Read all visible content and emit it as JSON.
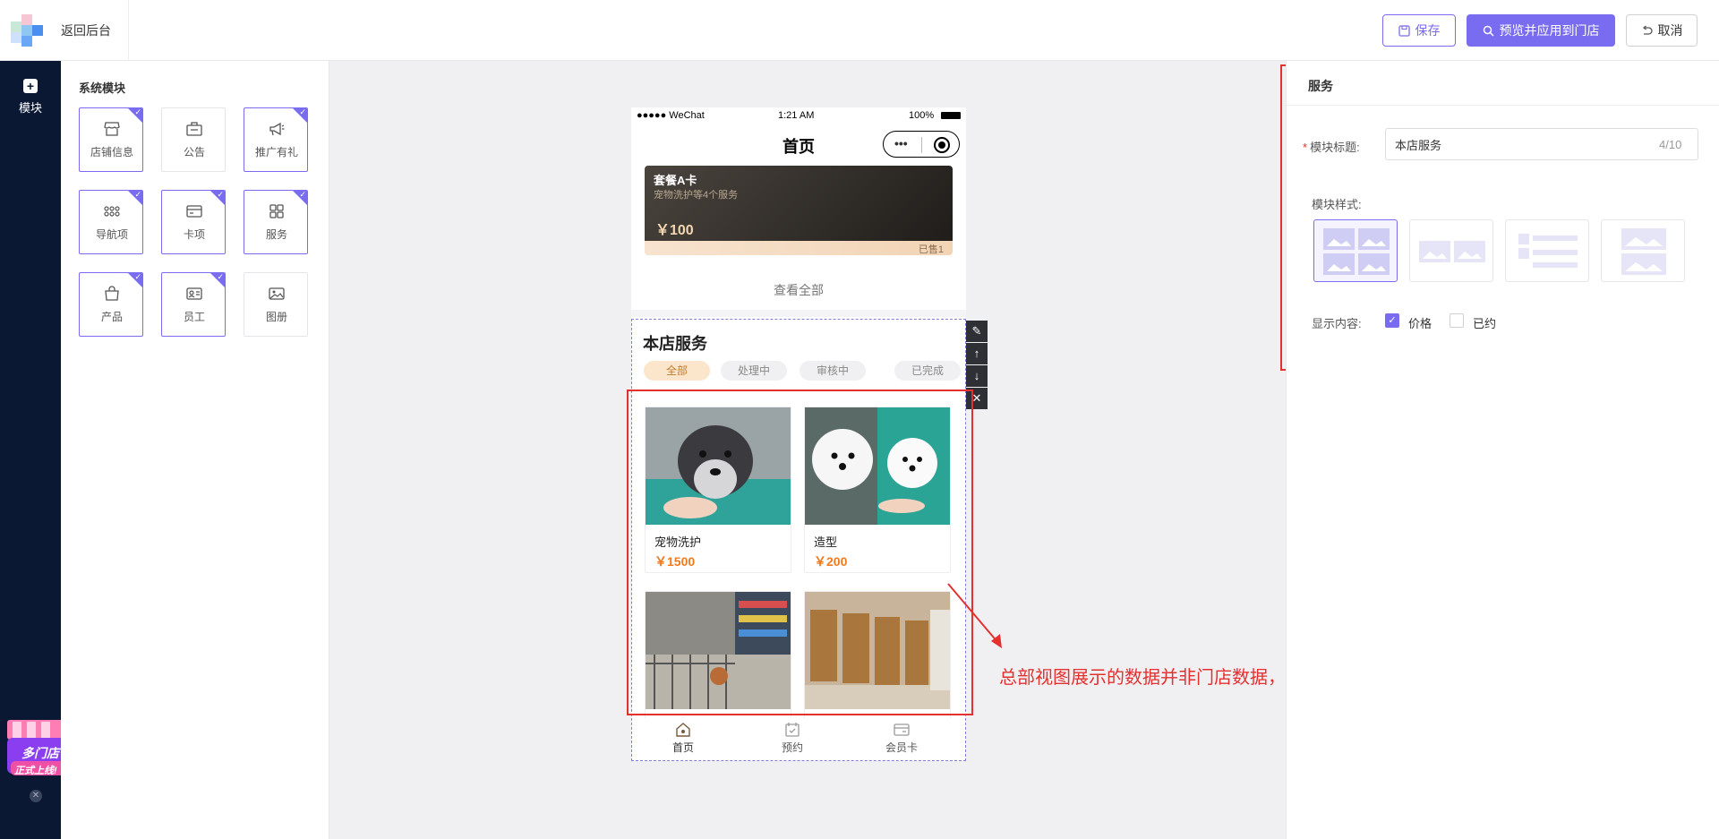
{
  "topbar": {
    "back_label": "返回后台",
    "save_label": "保存",
    "preview_label": "预览并应用到门店",
    "cancel_label": "取消"
  },
  "leftnav": {
    "module_label": "模块",
    "promo_line1": "多门店",
    "promo_line2": "正式上线!"
  },
  "module_panel": {
    "title": "系统模块",
    "tiles": [
      {
        "label": "店铺信息",
        "icon": "shop-icon",
        "active": true
      },
      {
        "label": "公告",
        "icon": "notice-icon",
        "active": false
      },
      {
        "label": "推广有礼",
        "icon": "megaphone-icon",
        "active": true
      },
      {
        "label": "导航项",
        "icon": "nav-dots-icon",
        "active": true
      },
      {
        "label": "卡项",
        "icon": "card-icon",
        "active": true
      },
      {
        "label": "服务",
        "icon": "grid-icon",
        "active": true
      },
      {
        "label": "产品",
        "icon": "bag-icon",
        "active": true
      },
      {
        "label": "员工",
        "icon": "id-card-icon",
        "active": true
      },
      {
        "label": "图册",
        "icon": "image-icon",
        "active": false
      }
    ]
  },
  "phone": {
    "status_left": "●●●●● WeChat",
    "status_time": "1:21 AM",
    "status_battery": "100%",
    "page_title": "首页",
    "capsule_dots": "•••",
    "card": {
      "title": "套餐A卡",
      "subtitle": "宠物洗护等4个服务",
      "price": "￥100",
      "sold": "已售1"
    },
    "view_all": "查看全部",
    "section_title": "本店服务",
    "tabs": [
      "全部",
      "处理中",
      "审核中",
      "已完成"
    ],
    "services": [
      {
        "name": "宠物洗护",
        "price": "￥1500"
      },
      {
        "name": "造型",
        "price": "￥200"
      },
      {
        "name": "",
        "price": ""
      },
      {
        "name": "",
        "price": ""
      }
    ],
    "tabbar": [
      "首页",
      "预约",
      "会员卡"
    ]
  },
  "tools": [
    "✎",
    "↑",
    "↓",
    "✕"
  ],
  "annotation": "总部视图展示的数据并非门店数据，查看门店展示数据需切换到门店视图",
  "right_panel": {
    "title": "服务",
    "title_label": "模块标题:",
    "title_value": "本店服务",
    "title_count": "4/10",
    "style_label": "模块样式:",
    "display_label": "显示内容:",
    "opt_price": "价格",
    "opt_booked": "已约"
  },
  "colors": {
    "accent": "#7a6cf0",
    "nav_bg": "#0b1833",
    "price": "#f07a1e",
    "annotation": "#e53030"
  }
}
